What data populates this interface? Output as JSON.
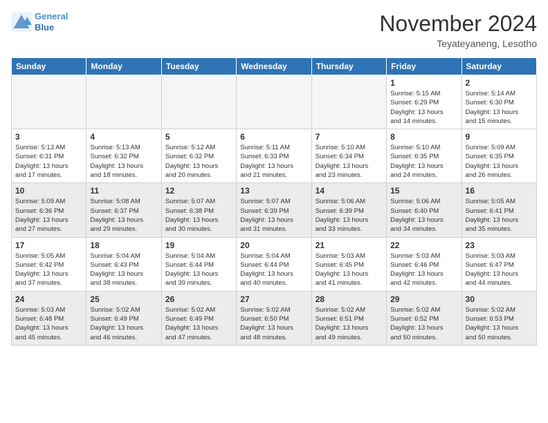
{
  "header": {
    "logo_line1": "General",
    "logo_line2": "Blue",
    "month": "November 2024",
    "location": "Teyateyaneng, Lesotho"
  },
  "weekdays": [
    "Sunday",
    "Monday",
    "Tuesday",
    "Wednesday",
    "Thursday",
    "Friday",
    "Saturday"
  ],
  "rows": [
    {
      "shaded": false,
      "cells": [
        {
          "day": "",
          "info": ""
        },
        {
          "day": "",
          "info": ""
        },
        {
          "day": "",
          "info": ""
        },
        {
          "day": "",
          "info": ""
        },
        {
          "day": "",
          "info": ""
        },
        {
          "day": "1",
          "info": "Sunrise: 5:15 AM\nSunset: 6:29 PM\nDaylight: 13 hours\nand 14 minutes."
        },
        {
          "day": "2",
          "info": "Sunrise: 5:14 AM\nSunset: 6:30 PM\nDaylight: 13 hours\nand 15 minutes."
        }
      ]
    },
    {
      "shaded": false,
      "cells": [
        {
          "day": "3",
          "info": "Sunrise: 5:13 AM\nSunset: 6:31 PM\nDaylight: 13 hours\nand 17 minutes."
        },
        {
          "day": "4",
          "info": "Sunrise: 5:13 AM\nSunset: 6:32 PM\nDaylight: 13 hours\nand 18 minutes."
        },
        {
          "day": "5",
          "info": "Sunrise: 5:12 AM\nSunset: 6:32 PM\nDaylight: 13 hours\nand 20 minutes."
        },
        {
          "day": "6",
          "info": "Sunrise: 5:11 AM\nSunset: 6:33 PM\nDaylight: 13 hours\nand 21 minutes."
        },
        {
          "day": "7",
          "info": "Sunrise: 5:10 AM\nSunset: 6:34 PM\nDaylight: 13 hours\nand 23 minutes."
        },
        {
          "day": "8",
          "info": "Sunrise: 5:10 AM\nSunset: 6:35 PM\nDaylight: 13 hours\nand 24 minutes."
        },
        {
          "day": "9",
          "info": "Sunrise: 5:09 AM\nSunset: 6:35 PM\nDaylight: 13 hours\nand 26 minutes."
        }
      ]
    },
    {
      "shaded": true,
      "cells": [
        {
          "day": "10",
          "info": "Sunrise: 5:09 AM\nSunset: 6:36 PM\nDaylight: 13 hours\nand 27 minutes."
        },
        {
          "day": "11",
          "info": "Sunrise: 5:08 AM\nSunset: 6:37 PM\nDaylight: 13 hours\nand 29 minutes."
        },
        {
          "day": "12",
          "info": "Sunrise: 5:07 AM\nSunset: 6:38 PM\nDaylight: 13 hours\nand 30 minutes."
        },
        {
          "day": "13",
          "info": "Sunrise: 5:07 AM\nSunset: 6:39 PM\nDaylight: 13 hours\nand 31 minutes."
        },
        {
          "day": "14",
          "info": "Sunrise: 5:06 AM\nSunset: 6:39 PM\nDaylight: 13 hours\nand 33 minutes."
        },
        {
          "day": "15",
          "info": "Sunrise: 5:06 AM\nSunset: 6:40 PM\nDaylight: 13 hours\nand 34 minutes."
        },
        {
          "day": "16",
          "info": "Sunrise: 5:05 AM\nSunset: 6:41 PM\nDaylight: 13 hours\nand 35 minutes."
        }
      ]
    },
    {
      "shaded": false,
      "cells": [
        {
          "day": "17",
          "info": "Sunrise: 5:05 AM\nSunset: 6:42 PM\nDaylight: 13 hours\nand 37 minutes."
        },
        {
          "day": "18",
          "info": "Sunrise: 5:04 AM\nSunset: 6:43 PM\nDaylight: 13 hours\nand 38 minutes."
        },
        {
          "day": "19",
          "info": "Sunrise: 5:04 AM\nSunset: 6:44 PM\nDaylight: 13 hours\nand 39 minutes."
        },
        {
          "day": "20",
          "info": "Sunrise: 5:04 AM\nSunset: 6:44 PM\nDaylight: 13 hours\nand 40 minutes."
        },
        {
          "day": "21",
          "info": "Sunrise: 5:03 AM\nSunset: 6:45 PM\nDaylight: 13 hours\nand 41 minutes."
        },
        {
          "day": "22",
          "info": "Sunrise: 5:03 AM\nSunset: 6:46 PM\nDaylight: 13 hours\nand 42 minutes."
        },
        {
          "day": "23",
          "info": "Sunrise: 5:03 AM\nSunset: 6:47 PM\nDaylight: 13 hours\nand 44 minutes."
        }
      ]
    },
    {
      "shaded": true,
      "cells": [
        {
          "day": "24",
          "info": "Sunrise: 5:03 AM\nSunset: 6:48 PM\nDaylight: 13 hours\nand 45 minutes."
        },
        {
          "day": "25",
          "info": "Sunrise: 5:02 AM\nSunset: 6:49 PM\nDaylight: 13 hours\nand 46 minutes."
        },
        {
          "day": "26",
          "info": "Sunrise: 5:02 AM\nSunset: 6:49 PM\nDaylight: 13 hours\nand 47 minutes."
        },
        {
          "day": "27",
          "info": "Sunrise: 5:02 AM\nSunset: 6:50 PM\nDaylight: 13 hours\nand 48 minutes."
        },
        {
          "day": "28",
          "info": "Sunrise: 5:02 AM\nSunset: 6:51 PM\nDaylight: 13 hours\nand 49 minutes."
        },
        {
          "day": "29",
          "info": "Sunrise: 5:02 AM\nSunset: 6:52 PM\nDaylight: 13 hours\nand 50 minutes."
        },
        {
          "day": "30",
          "info": "Sunrise: 5:02 AM\nSunset: 6:53 PM\nDaylight: 13 hours\nand 50 minutes."
        }
      ]
    }
  ]
}
